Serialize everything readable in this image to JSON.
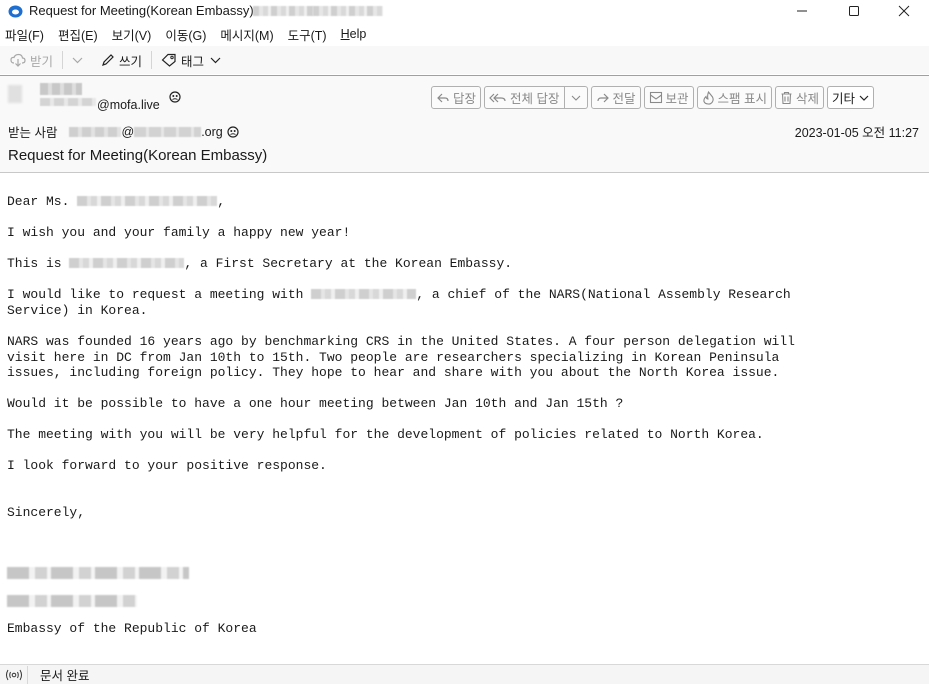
{
  "window": {
    "title": "Request for Meeting(Korean Embassy)",
    "title_suffix_redacted": true,
    "controls": {
      "minimize": "minimize",
      "maximize": "maximize",
      "close": "close"
    }
  },
  "menubar": {
    "items": [
      {
        "label": "파일(F)"
      },
      {
        "label": "편집(E)"
      },
      {
        "label": "보기(V)"
      },
      {
        "label": "이동(G)"
      },
      {
        "label": "메시지(M)"
      },
      {
        "label": "도구(T)"
      },
      {
        "label": "Help"
      }
    ]
  },
  "toolbar": {
    "receive_label": "받기",
    "compose_label": "쓰기",
    "tag_label": "태그"
  },
  "header": {
    "sender_domain": "@mofa.live",
    "recipient_label": "받는 사람",
    "recipient_at": "@",
    "recipient_tld": ".org",
    "subject": "Request for Meeting(Korean Embassy)",
    "datetime": "2023-01-05 오전 11:27",
    "actions": {
      "reply": "답장",
      "reply_all": "전체 답장",
      "forward": "전달",
      "archive": "보관",
      "spam": "스팸 표시",
      "delete": "삭제",
      "more": "기타"
    }
  },
  "message": {
    "greeting_prefix": "Dear Ms. ",
    "greeting_suffix": ",",
    "p1": "I wish you and your family a happy new year!",
    "p2_prefix": "This is ",
    "p2_suffix": ", a First Secretary at the Korean Embassy.",
    "p3_prefix": "I would like to request a meeting with ",
    "p3_suffix": ", a chief of the NARS(National Assembly Research\nService) in Korea.",
    "p4": "NARS was founded 16 years ago by benchmarking CRS in the United States. A four person delegation will\nvisit here in DC from Jan 10th to 15th. Two people are researchers specializing in Korean Peninsula\nissues, including foreign policy. They hope to hear and share with you about the North Korea issue.",
    "p5": "Would it be possible to have a one hour meeting between Jan 10th and Jan 15th ?",
    "p6": "The meeting with you will be very helpful for the development of policies related to North Korea.",
    "p7": "I look forward to your positive response.",
    "closing": "Sincerely,",
    "signature_org": "Embassy of the Republic of Korea"
  },
  "statusbar": {
    "status": "문서 완료"
  }
}
